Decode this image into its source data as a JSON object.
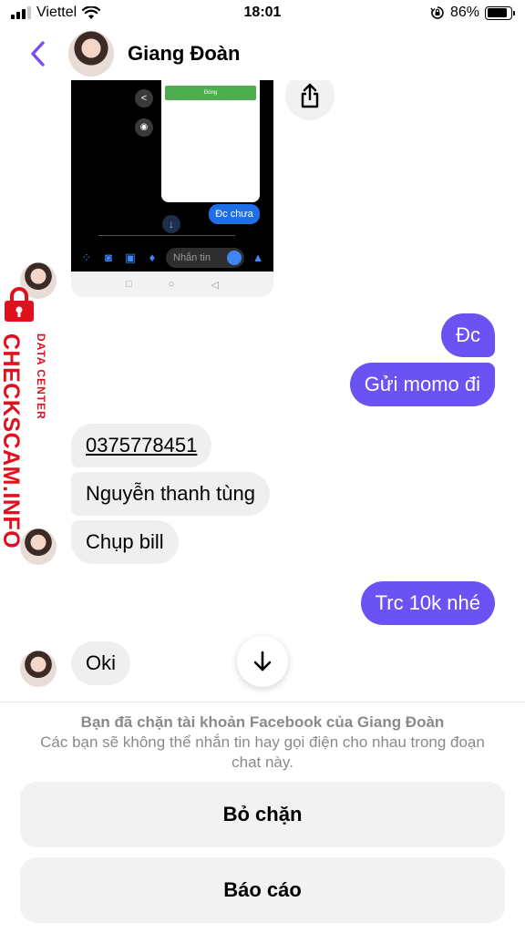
{
  "status_bar": {
    "carrier": "Viettel",
    "time": "18:01",
    "battery": "86%",
    "battery_level": 0.86
  },
  "header": {
    "contact_name": "Giang Đoàn"
  },
  "attachment": {
    "button_label": "Đóng",
    "bubble": "Đc chưa",
    "input_placeholder": "Nhắn tin"
  },
  "messages": [
    {
      "sender": "me",
      "text": "Đc"
    },
    {
      "sender": "me",
      "text": "Gửi momo đi"
    },
    {
      "sender": "contact",
      "text": "0375778451"
    },
    {
      "sender": "contact",
      "text": "Nguyễn thanh tùng"
    },
    {
      "sender": "contact",
      "text": "Chụp bill"
    },
    {
      "sender": "me",
      "text": "Trc 10k nhé"
    },
    {
      "sender": "contact",
      "text": "Oki"
    }
  ],
  "watermark": {
    "main": "CHECKSCAM.INFO",
    "sub": "DATA CENTER"
  },
  "blocked": {
    "title": "Bạn đã chặn tài khoản Facebook của Giang Đoàn",
    "description": "Các bạn sẽ không thể nhắn tin hay gọi điện cho nhau trong đoạn chat này."
  },
  "actions": {
    "unblock": "Bỏ chặn",
    "report": "Báo cáo"
  },
  "colors": {
    "accent": "#6b52f2",
    "incoming": "#efefef",
    "back": "#7b4cf0",
    "watermark": "#e0101e"
  }
}
